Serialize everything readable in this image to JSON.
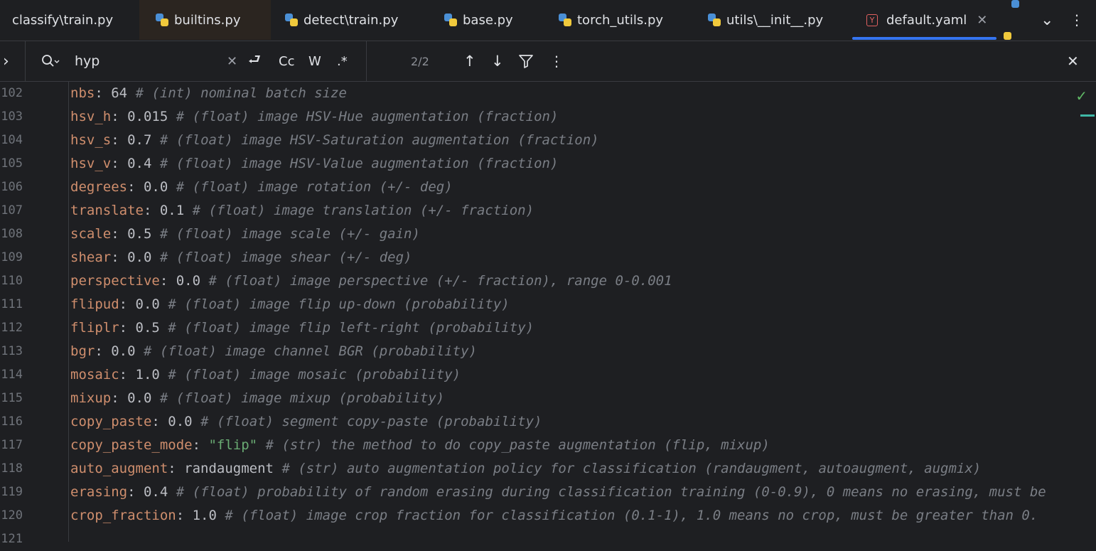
{
  "tabs": [
    {
      "label": "classify\\train.py",
      "icon": "python-icon"
    },
    {
      "label": "builtins.py",
      "icon": "python-icon"
    },
    {
      "label": "detect\\train.py",
      "icon": "python-icon"
    },
    {
      "label": "base.py",
      "icon": "python-icon"
    },
    {
      "label": "torch_utils.py",
      "icon": "python-icon"
    },
    {
      "label": "utils\\__init__.py",
      "icon": "python-icon"
    },
    {
      "label": "default.yaml",
      "icon": "yaml-icon",
      "active": true
    }
  ],
  "tab_controls": {
    "close_glyph": "✕",
    "more_glyph": "⋮",
    "dropdown_glyph": "⌄"
  },
  "yaml_icon_letter": "Y",
  "find": {
    "expand_glyph": "›",
    "query": "hyp",
    "clear_glyph": "✕",
    "options": {
      "wrap": "⮐",
      "case": "Cc",
      "word": "W",
      "regex": ".*"
    },
    "match_count": "2/2",
    "prev_glyph": "↑",
    "next_glyph": "↓",
    "filter_glyph": "⏷",
    "more_glyph": "⋮",
    "close_glyph": "✕"
  },
  "editor": {
    "status_glyph": "✓",
    "lines": [
      {
        "num": "102",
        "key": "nbs",
        "value": "64",
        "comment": "# (int) nominal batch size"
      },
      {
        "num": "103",
        "key": "hsv_h",
        "value": "0.015",
        "comment": "# (float) image HSV-Hue augmentation (fraction)"
      },
      {
        "num": "104",
        "key": "hsv_s",
        "value": "0.7",
        "comment": "# (float) image HSV-Saturation augmentation (fraction)"
      },
      {
        "num": "105",
        "key": "hsv_v",
        "value": "0.4",
        "comment": "# (float) image HSV-Value augmentation (fraction)"
      },
      {
        "num": "106",
        "key": "degrees",
        "value": "0.0",
        "comment": "# (float) image rotation (+/- deg)"
      },
      {
        "num": "107",
        "key": "translate",
        "value": "0.1",
        "comment": "# (float) image translation (+/- fraction)"
      },
      {
        "num": "108",
        "key": "scale",
        "value": "0.5",
        "comment": "# (float) image scale (+/- gain)"
      },
      {
        "num": "109",
        "key": "shear",
        "value": "0.0",
        "comment": "# (float) image shear (+/- deg)"
      },
      {
        "num": "110",
        "key": "perspective",
        "value": "0.0",
        "comment": "# (float) image perspective (+/- fraction), range 0-0.001"
      },
      {
        "num": "111",
        "key": "flipud",
        "value": "0.0",
        "comment": "# (float) image flip up-down (probability)"
      },
      {
        "num": "112",
        "key": "fliplr",
        "value": "0.5",
        "comment": "# (float) image flip left-right (probability)"
      },
      {
        "num": "113",
        "key": "bgr",
        "value": "0.0",
        "comment": "# (float) image channel BGR (probability)"
      },
      {
        "num": "114",
        "key": "mosaic",
        "value": "1.0",
        "comment": "# (float) image mosaic (probability)"
      },
      {
        "num": "115",
        "key": "mixup",
        "value": "0.0",
        "comment": "# (float) image mixup (probability)"
      },
      {
        "num": "116",
        "key": "copy_paste",
        "value": "0.0",
        "comment": "# (float) segment copy-paste (probability)"
      },
      {
        "num": "117",
        "key": "copy_paste_mode",
        "value": "\"flip\"",
        "string": true,
        "comment": "# (str) the method to do copy_paste augmentation (flip, mixup)"
      },
      {
        "num": "118",
        "key": "auto_augment",
        "value": "randaugment",
        "comment": "# (str) auto augmentation policy for classification (randaugment, autoaugment, augmix)"
      },
      {
        "num": "119",
        "key": "erasing",
        "value": "0.4",
        "comment": "# (float) probability of random erasing during classification training (0-0.9), 0 means no erasing, must be"
      },
      {
        "num": "120",
        "key": "crop_fraction",
        "value": "1.0",
        "comment": "# (float) image crop fraction for classification (0.1-1), 1.0 means no crop, must be greater than 0."
      },
      {
        "num": "121",
        "key": "",
        "value": "",
        "comment": ""
      }
    ]
  },
  "colors": {
    "background": "#1e1f22",
    "accent": "#3574f0",
    "key": "#cf8e6d",
    "comment": "#7a7e85",
    "string": "#6aab73"
  }
}
